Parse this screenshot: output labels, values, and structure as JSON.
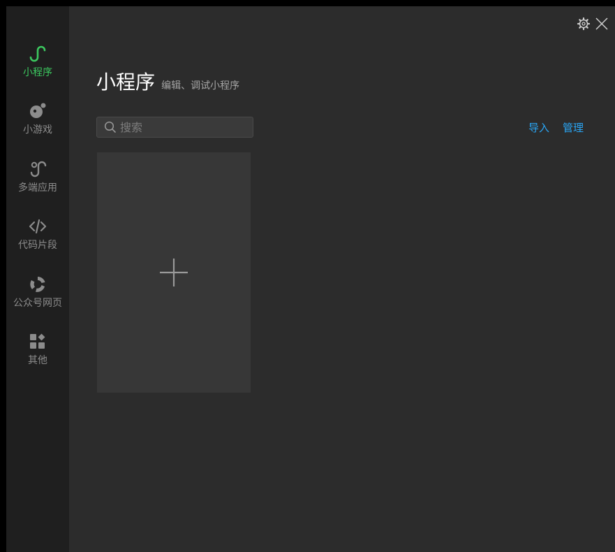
{
  "sidebar": {
    "items": [
      {
        "label": "小程序",
        "icon": "miniprogram-icon",
        "active": true
      },
      {
        "label": "小游戏",
        "icon": "minigame-icon",
        "active": false
      },
      {
        "label": "多端应用",
        "icon": "multiplatform-icon",
        "active": false
      },
      {
        "label": "代码片段",
        "icon": "code-icon",
        "active": false
      },
      {
        "label": "公众号网页",
        "icon": "webpage-icon",
        "active": false
      },
      {
        "label": "其他",
        "icon": "widgets-icon",
        "active": false
      }
    ]
  },
  "topbar": {
    "icons": [
      "gear-icon",
      "close-icon"
    ]
  },
  "main": {
    "title": "小程序",
    "subtitle": "编辑、调试小程序",
    "search": {
      "placeholder": "搜索",
      "value": ""
    },
    "actions": {
      "import_label": "导入",
      "manage_label": "管理"
    },
    "create_card": {
      "icon": "plus-icon"
    }
  },
  "colors": {
    "accent_green": "#3cc85f",
    "link_blue": "#2aa6f5",
    "sidebar_bg": "#1f1f1f",
    "content_bg": "#2c2c2c",
    "card_bg": "#373737"
  }
}
